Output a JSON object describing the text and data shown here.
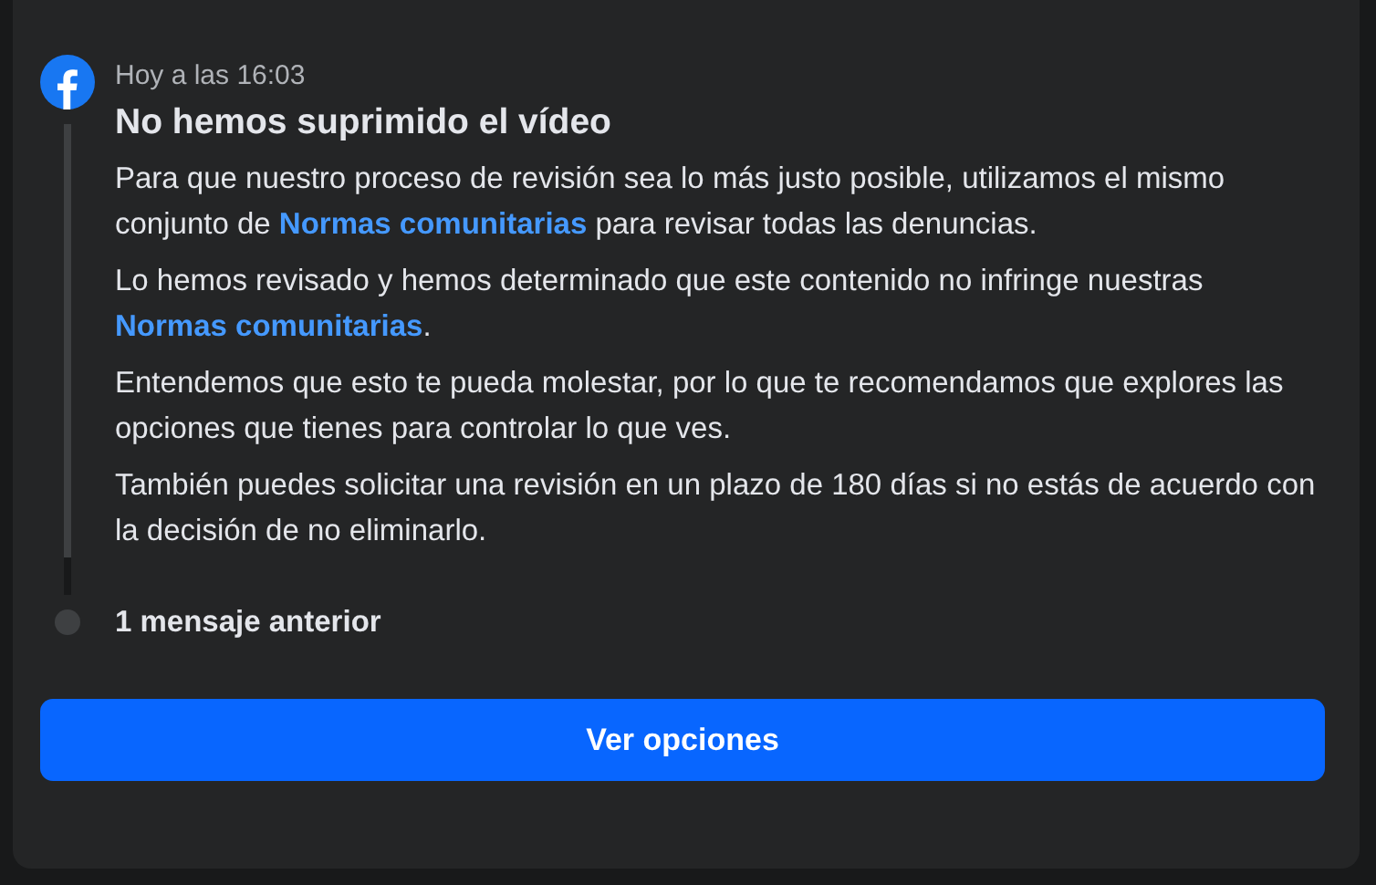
{
  "notification": {
    "time": "Hoy a las 16:03",
    "title": "No hemos suprimido el vídeo",
    "paragraphs": [
      [
        {
          "kind": "text",
          "text": "Para que nuestro proceso de revisión sea lo más justo posible, utilizamos el mismo conjunto de "
        },
        {
          "kind": "link",
          "text": "Normas comunitarias"
        },
        {
          "kind": "text",
          "text": " para revisar todas las denuncias."
        }
      ],
      [
        {
          "kind": "text",
          "text": "Lo hemos revisado y hemos determinado que este contenido no infringe nuestras "
        },
        {
          "kind": "link",
          "text": "Normas comunitarias"
        },
        {
          "kind": "text",
          "text": "."
        }
      ],
      [
        {
          "kind": "text",
          "text": "Entendemos que esto te pueda molestar, por lo que te recomendamos que explores las opciones que tienes para controlar lo que ves."
        }
      ],
      [
        {
          "kind": "text",
          "text": "También puedes solicitar una revisión en un plazo de 180 días si no estás de acuerdo con la decisión de no eliminarlo."
        }
      ]
    ]
  },
  "previous": {
    "label": "1 mensaje anterior"
  },
  "button": {
    "label": "Ver opciones"
  }
}
